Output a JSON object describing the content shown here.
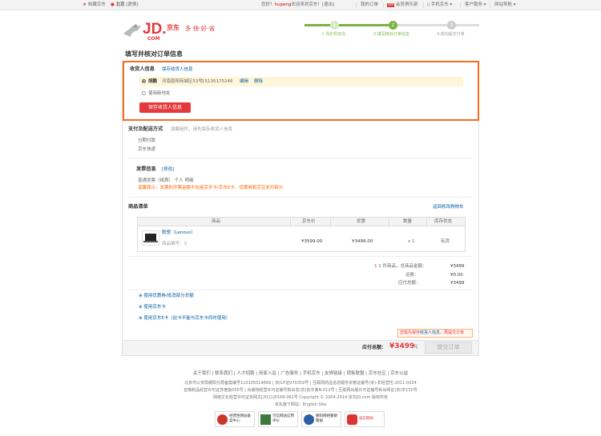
{
  "topbar": {
    "fav": "收藏京东",
    "location": "北京",
    "change": "[更换]",
    "greeting_pre": "您好！",
    "username": "hupeng",
    "greeting_post": "欢迎来到京东！",
    "logout": "[退出]",
    "my_orders": "我的订单",
    "vip": "会员俱乐部",
    "mobile": "手机京东",
    "service": "客户服务",
    "nav": "网站导航"
  },
  "logo": {
    "brand": "JD.",
    "com": "COM",
    "cn": "京东",
    "slogan": "多·快·好·省"
  },
  "steps": [
    {
      "num": "1",
      "label": "1.我的购物车"
    },
    {
      "num": "2",
      "label": "2.填写核对订单信息"
    },
    {
      "num": "3",
      "label": "3.成功提交订单"
    }
  ],
  "page_title": "填写并核对订单信息",
  "receiver": {
    "heading": "收货人信息",
    "save_link": "保存收货人信息",
    "name": "胡鹏",
    "address": "河南南阳宛城区53号",
    "phone": "15136175246",
    "edit": "编辑",
    "delete": "删除",
    "new_addr": "使用新地址",
    "save_btn": "保存收货人信息"
  },
  "payment": {
    "heading": "支付及配送方式",
    "hint": "加载组件，请先保存收货人信息",
    "pay_method": "分期付款",
    "delivery": "京东快递"
  },
  "invoice": {
    "heading": "发票信息",
    "modify": "[修改]",
    "info": "普通发票（纸质）  个人  明细",
    "tip": "温馨提示：发票的开票金额不包括京东卡/京东E卡、优惠券和京豆支付部分"
  },
  "goods": {
    "heading": "商品清单",
    "back_cart": "返回修改购物车",
    "columns": [
      "商品",
      "京东价",
      "优惠",
      "数量",
      "库存状态"
    ],
    "item": {
      "name": "联想（Lenovo）",
      "code": "商品编号：3",
      "price": "¥3599.00",
      "discount": "¥3499.00",
      "qty": "x 1",
      "stock": "有货"
    }
  },
  "summary": {
    "count_pre": "1 件商品，总商品金额：",
    "total": "¥3499",
    "freight_label": "运费：",
    "freight": "¥0.00",
    "payable_label": "应付总额：",
    "payable": "¥3499"
  },
  "coupons": {
    "coupon": "使用优惠券/抵消部分总额",
    "jdcard": "使用京东卡",
    "ecard": "使用京东E卡（此卡不能与京东卡同时使用）"
  },
  "reminder": "您需先保存 收货人信息，再提交订单",
  "reminder_parts": {
    "pre": "您需先保存",
    "link": "收货人信息",
    "post": "，再提交订单"
  },
  "bottom": {
    "label": "应付总额：",
    "amount": "¥3499",
    "unit": "元",
    "submit": "提交订单"
  },
  "footer": {
    "links": [
      "关于我们",
      "联系我们",
      "人才招聘",
      "商家入驻",
      "广告服务",
      "手机京东",
      "友情链接",
      "销售联盟",
      "京东社区",
      "京东公益"
    ],
    "line1": "北京市公安局朝阳分局备案编号110105014669  |  京ICP证070359号  |  互联网药品信息服务资格证编号(京)-非经营性-2011-0034",
    "line2": "音像制品经营许可证苏宿批005号  |  出版物经营许可证编号新出发(苏)批字第N-012号  |  互联网出版许可证编号新出网证(京)字150号",
    "line3": "网络文化经营许可证京网文[2011]0168-061号   Copyright © 2004-2014 京东JD.com 版权所有",
    "line4": "京东旗下网站：English Site",
    "badges": [
      "经营性网站备案中心",
      "可信网站信用评价",
      "朝阳网络警察警报",
      "诚信网站"
    ]
  }
}
